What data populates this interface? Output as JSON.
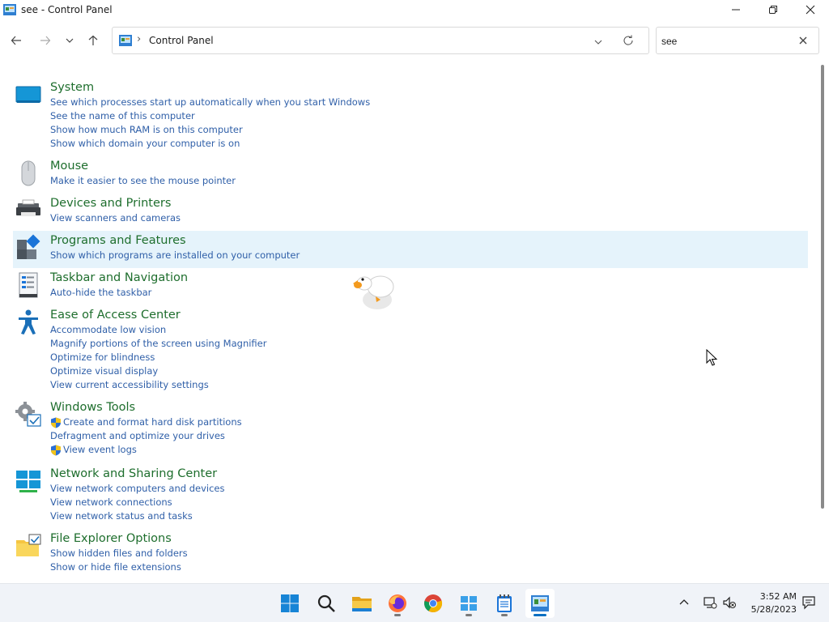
{
  "window": {
    "title": "see - Control Panel"
  },
  "address": {
    "path": "Control Panel",
    "separator": "›"
  },
  "search": {
    "value": "see",
    "placeholder": ""
  },
  "results": [
    {
      "title": "System",
      "icon": "monitor-icon",
      "links": [
        {
          "text": "See which processes start up automatically when you start Windows"
        },
        {
          "text": "See the name of this computer"
        },
        {
          "text": "Show how much RAM is on this computer"
        },
        {
          "text": "Show which domain your computer is on"
        }
      ]
    },
    {
      "title": "Mouse",
      "icon": "mouse-icon",
      "links": [
        {
          "text": "Make it easier to see the mouse pointer"
        }
      ]
    },
    {
      "title": "Devices and Printers",
      "icon": "printer-icon",
      "links": [
        {
          "text": "View scanners and cameras"
        }
      ]
    },
    {
      "title": "Programs and Features",
      "icon": "programs-icon",
      "links": [
        {
          "text": "Show which programs are installed on your computer"
        }
      ]
    },
    {
      "title": "Taskbar and Navigation",
      "icon": "taskbar-icon",
      "links": [
        {
          "text": "Auto-hide the taskbar"
        }
      ]
    },
    {
      "title": "Ease of Access Center",
      "icon": "accessibility-icon",
      "links": [
        {
          "text": "Accommodate low vision"
        },
        {
          "text": "Magnify portions of the screen using Magnifier"
        },
        {
          "text": "Optimize for blindness"
        },
        {
          "text": "Optimize visual display"
        },
        {
          "text": "View current accessibility settings"
        }
      ]
    },
    {
      "title": "Windows Tools",
      "icon": "tools-gear-icon",
      "links": [
        {
          "text": "Create and format hard disk partitions",
          "shield": true
        },
        {
          "text": "Defragment and optimize your drives"
        },
        {
          "text": "View event logs",
          "shield": true
        }
      ]
    },
    {
      "title": "Network and Sharing Center",
      "icon": "network-icon",
      "links": [
        {
          "text": "View network computers and devices"
        },
        {
          "text": "View network connections"
        },
        {
          "text": "View network status and tasks"
        }
      ]
    },
    {
      "title": "File Explorer Options",
      "icon": "folder-options-icon",
      "links": [
        {
          "text": "Show hidden files and folders"
        },
        {
          "text": "Show or hide file extensions"
        }
      ]
    }
  ],
  "taskbar": {
    "apps": [
      "start-icon",
      "search-icon",
      "file-explorer-icon",
      "firefox-icon",
      "chrome-icon",
      "app-grid-icon",
      "notepad-icon",
      "control-panel-icon"
    ],
    "clock": {
      "time": "3:52 AM",
      "date": "5/28/2023"
    }
  },
  "colors": {
    "heading": "#1e6e2d",
    "link": "#2f5fa8",
    "highlight": "#e5f3fb",
    "accent": "#0a6fc2"
  }
}
